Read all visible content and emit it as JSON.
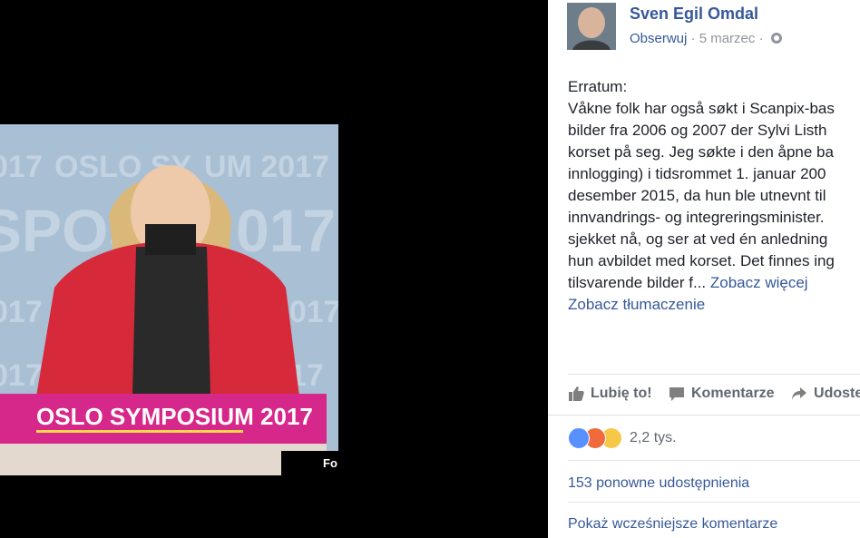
{
  "photo": {
    "credit": "Fo",
    "sign_text": "OSLO SYMPOSIUM 2017"
  },
  "post": {
    "author": "Sven Egil Omdal",
    "follow_label": "Obserwuj",
    "date": "5 marzec",
    "separator": "·",
    "text_lines": [
      "Erratum:",
      "Våkne folk har også søkt i Scanpix-bas",
      "bilder fra 2006 og 2007 der Sylvi Listh",
      "korset på seg. Jeg søkte i den åpne ba",
      "innlogging) i tidsrommet 1. januar 200",
      "desember 2015, da hun ble utnevnt til",
      "innvandrings- og integreringsminister.",
      "sjekket nå, og ser at ved én anledning",
      "hun avbildet med korset. Det finnes ing"
    ],
    "last_line_text": "tilsvarende bilder f...",
    "see_more": "Zobacz więcej",
    "see_translation": "Zobacz tłumaczenie"
  },
  "actions": {
    "like": "Lubię to!",
    "comment": "Komentarze",
    "share": "Udoste"
  },
  "reactions": {
    "count": "2,2 tys."
  },
  "shares": {
    "label": "153 ponowne udostępnienia"
  },
  "comments": {
    "previous_label": "Pokaż wcześniejsze komentarze"
  },
  "colors": {
    "link": "#365899",
    "text": "#1d2129",
    "muted": "#616770",
    "podium": "#d6278a",
    "jacket": "#d62a3a"
  }
}
